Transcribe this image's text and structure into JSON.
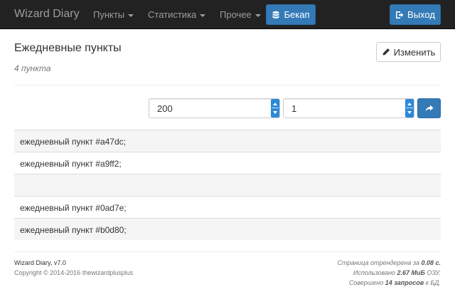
{
  "navbar": {
    "brand": "Wizard Diary",
    "menu_points": "Пункты",
    "menu_stats": "Статистика",
    "menu_other": "Прочее",
    "backup_label": "Бекап",
    "logout_label": "Выход"
  },
  "header": {
    "title": "Ежедневные пункты",
    "count": "4 пункта",
    "edit_label": "Изменить"
  },
  "pagination": {
    "page_size": "200",
    "page": "1"
  },
  "list": {
    "items": [
      "ежедневный пункт #a47dc;",
      "ежедневный пункт #a9ff2;",
      "",
      "ежедневный пункт #0ad7e;",
      "ежедневный пункт #b0d80;"
    ]
  },
  "footer": {
    "version": "Wizard Diary, v7.0",
    "copyright": "Copyright © 2014-2016 thewizardplusplus",
    "render_prefix": "Страница отрендерена за ",
    "render_value": "0.08 с.",
    "memory_prefix": "Использовано ",
    "memory_value": "2.67 МиБ",
    "memory_suffix": " ОЗУ.",
    "queries_prefix": "Совершено ",
    "queries_value": "14 запросов",
    "queries_suffix": " к БД."
  },
  "colors": {
    "navbar_bg": "#222222",
    "primary": "#337ab7",
    "row_stripe": "#f5f5f5"
  },
  "icons": {
    "backup": "database-icon",
    "logout": "logout-icon",
    "edit": "pencil-icon",
    "go": "share-arrow-icon"
  }
}
